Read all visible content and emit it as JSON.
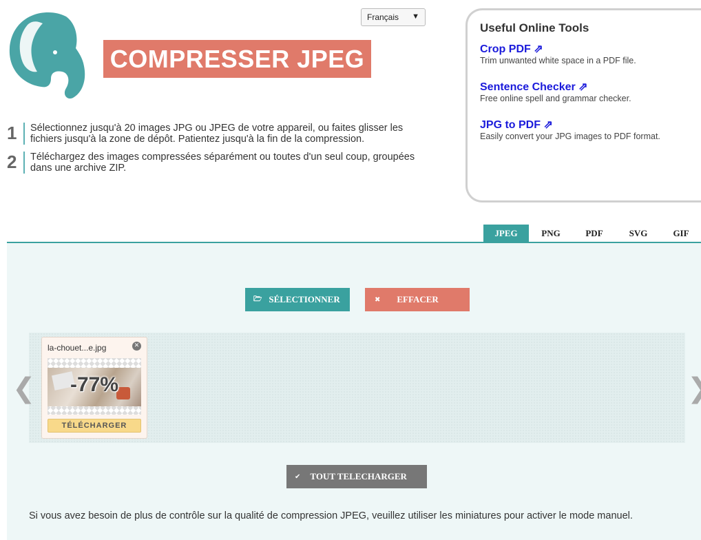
{
  "header": {
    "title": "COMPRESSER JPEG",
    "language": "Français"
  },
  "steps": [
    {
      "number": "1",
      "text": "Sélectionnez jusqu'à 20 images JPG ou JPEG de votre appareil, ou faites glisser les fichiers jusqu'à la zone de dépôt. Patientez jusqu'à la fin de la compression."
    },
    {
      "number": "2",
      "text": "Téléchargez des images compressées séparément ou toutes d'un seul coup, groupées dans une archive ZIP."
    }
  ],
  "tools": {
    "heading": "Useful Online Tools",
    "items": [
      {
        "name": "Crop PDF ⇗",
        "desc": "Trim unwanted white space in a PDF file."
      },
      {
        "name": "Sentence Checker ⇗",
        "desc": "Free online spell and grammar checker."
      },
      {
        "name": "JPG to PDF ⇗",
        "desc": "Easily convert your JPG images to PDF format."
      }
    ]
  },
  "tabs": [
    "JPEG",
    "PNG",
    "PDF",
    "SVG",
    "GIF"
  ],
  "active_tab": "JPEG",
  "buttons": {
    "select": "SÉLECTIONNER",
    "clear": "EFFACER",
    "download_all": "TOUT TELECHARGER"
  },
  "file": {
    "name": "la-chouet...e.jpg",
    "reduction": "-77%",
    "download": "TÉLÉCHARGER"
  },
  "note": "Si vous avez besoin de plus de contrôle sur la qualité de compression JPEG, veuillez utiliser les miniatures pour activer le mode manuel.",
  "colors": {
    "accent": "#3aa19f",
    "salmon": "#e07a6a",
    "link": "#1a1adb",
    "download_btn": "#f8d98a"
  },
  "icons": {
    "logo": "elephant-logo-icon",
    "select": "folder-open-icon",
    "clear": "close-x-icon",
    "download_all": "checkmark-icon",
    "remove_file": "close-circle-icon",
    "carousel_prev": "chevron-left-icon",
    "carousel_next": "chevron-right-icon"
  }
}
